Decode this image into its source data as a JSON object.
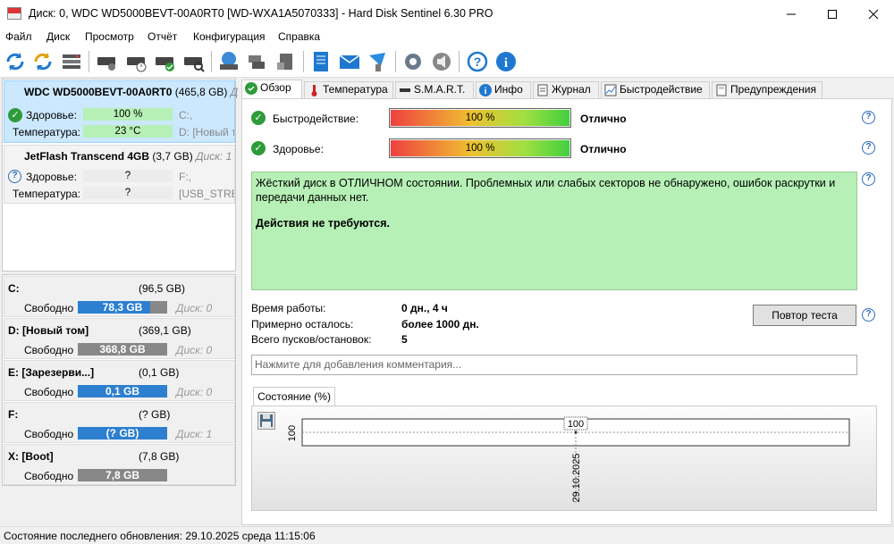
{
  "window": {
    "title": "Диск: 0, WDC WD5000BEVT-00A0RT0 [WD-WXA1A5070333]  -  Hard Disk Sentinel 6.30 PRO",
    "min_icon": "minimize-icon",
    "max_icon": "maximize-icon",
    "close_icon": "close-icon"
  },
  "menu": [
    "Файл",
    "Диск",
    "Просмотр",
    "Отчёт",
    "Конфигурация",
    "Справка"
  ],
  "disks": [
    {
      "name": "WDC WD5000BEVT-00A0RT0",
      "size": "(465,8 GB)",
      "disk_label": "Д",
      "health_label": "Здоровье:",
      "health_value": "100 %",
      "health_part": "C:,",
      "temp_label": "Температура:",
      "temp_value": "23 °C",
      "temp_part": "D: [Новый т"
    },
    {
      "name": "JetFlash Transcend 4GB",
      "size": "(3,7 GB)",
      "disk_label": "Диск: 1",
      "health_label": "Здоровье:",
      "health_value": "?",
      "health_part": "F:,",
      "temp_label": "Температура:",
      "temp_value": "?",
      "temp_part": "[USB_STREL"
    }
  ],
  "volumes": [
    {
      "name": "C:",
      "size": "(96,5 GB)",
      "free_label": "Свободно",
      "free": "78,3 GB",
      "free_fraction": 0.81,
      "disk": "Диск: 0"
    },
    {
      "name": "D: [Новый том]",
      "size": "(369,1 GB)",
      "free_label": "Свободно",
      "free": "368,8 GB",
      "free_fraction": 0.0,
      "disk": "Диск: 0"
    },
    {
      "name": "E: [Зарезерви...]",
      "size": "(0,1 GB)",
      "free_label": "Свободно",
      "free": "0,1 GB",
      "free_fraction": 1.0,
      "disk": "Диск: 0"
    },
    {
      "name": "F:",
      "size": "(? GB)",
      "free_label": "Свободно",
      "free": "(? GB)",
      "free_fraction": 1.0,
      "disk": "Диск: 1"
    },
    {
      "name": "X: [Boot]",
      "size": "(7,8 GB)",
      "free_label": "Свободно",
      "free": "7,8 GB",
      "free_fraction": 0.0,
      "disk": ""
    }
  ],
  "tabs": [
    "Обзор",
    "Температура",
    "S.M.A.R.T.",
    "Инфо",
    "Журнал",
    "Быстродействие",
    "Предупреждения"
  ],
  "overview": {
    "perf_label": "Быстродействие:",
    "perf_value": "100 %",
    "perf_fraction": 1.0,
    "perf_status": "Отлично",
    "health_label": "Здоровье:",
    "health_value": "100 %",
    "health_fraction": 1.0,
    "health_status": "Отлично",
    "status_text": "Жёсткий диск в ОТЛИЧНОМ состоянии. Проблемных или слабых секторов не обнаружено, ошибок раскрутки и передачи данных нет.",
    "action_text": "Действия не требуются.",
    "uptime_label": "Время работы:",
    "uptime_value": "0 дн., 4 ч",
    "remaining_label": "Примерно осталось:",
    "remaining_value": "более 1000 дн.",
    "starts_label": "Всего пусков/остановок:",
    "starts_value": "5",
    "retest_button": "Повтор теста",
    "comment_placeholder": "Нажмите для добавления комментария..."
  },
  "chart_tab": "Состояние (%)",
  "chart_data": {
    "type": "line",
    "x": [
      "29.10.2025"
    ],
    "series": [
      {
        "values": [
          100
        ]
      }
    ],
    "ylabel": "",
    "ytick": "100",
    "point_label": "100"
  },
  "statusbar": {
    "text": "Состояние последнего обновления: 29.10.2025 среда 11:15:06"
  },
  "colors": {
    "accent": "#2a6bc0",
    "ok_green": "#b6f0b6",
    "volume_bar": "#2d7fd0"
  }
}
